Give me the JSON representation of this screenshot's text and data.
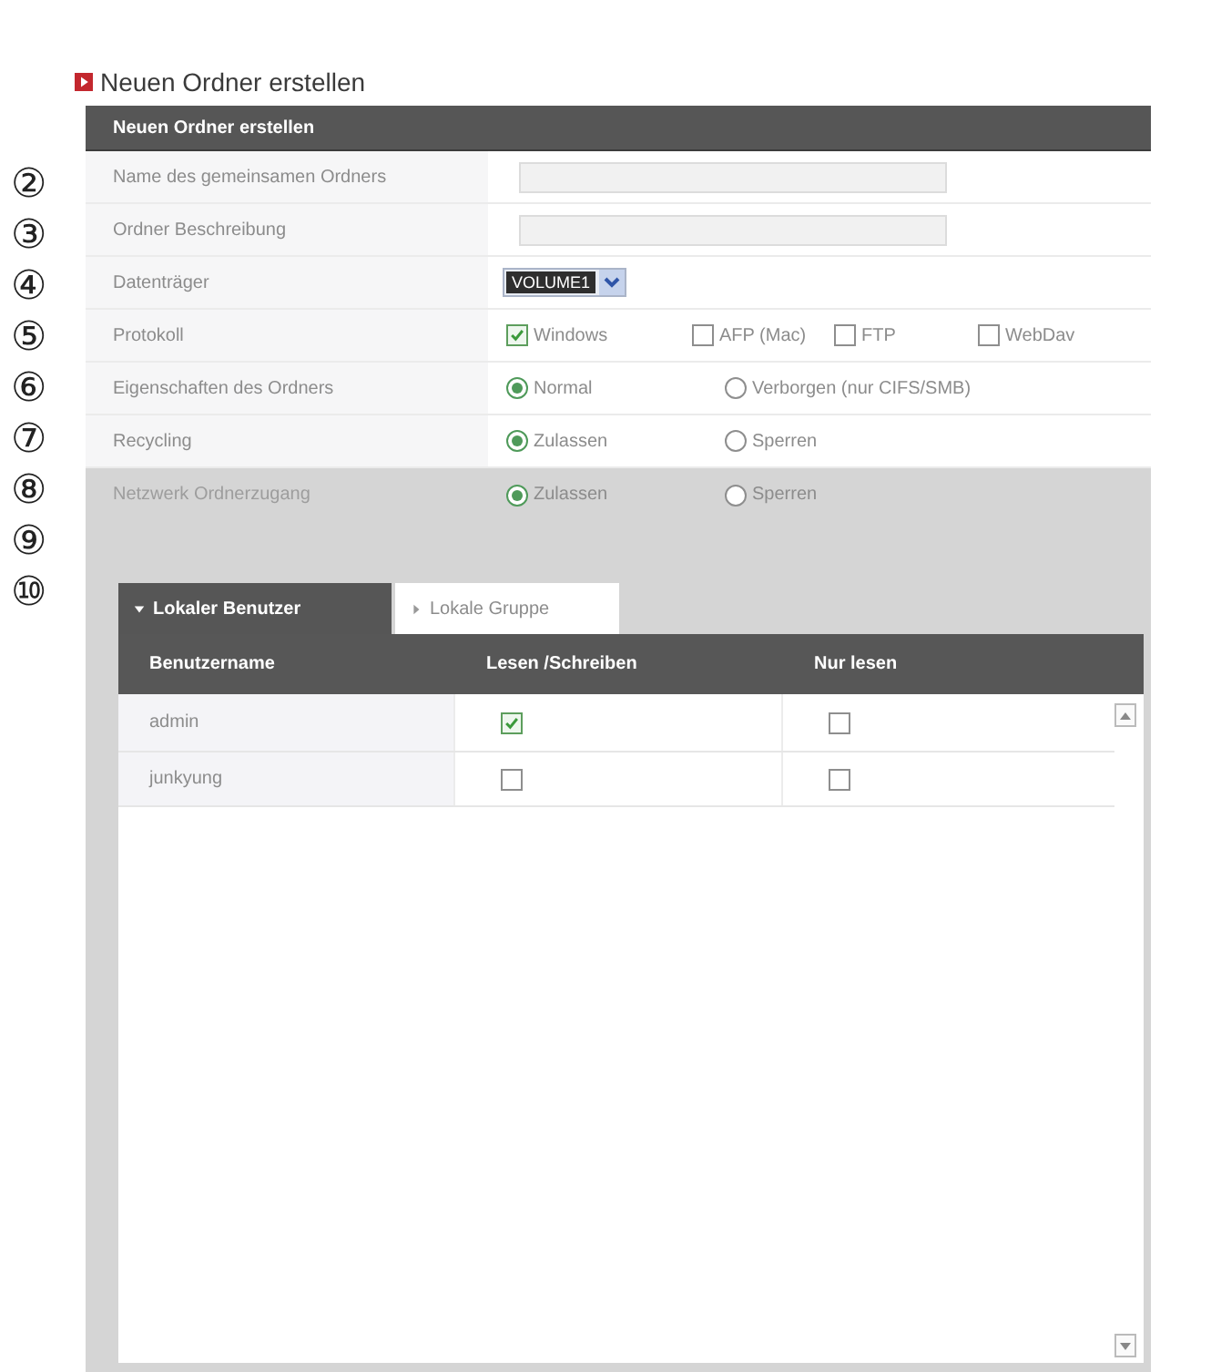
{
  "page_title": "Neuen Ordner erstellen",
  "callouts": [
    "②",
    "③",
    "④",
    "⑤",
    "⑥",
    "⑦",
    "⑧",
    "⑨",
    "⑩"
  ],
  "panel": {
    "title": "Neuen Ordner erstellen",
    "rows": [
      {
        "kind": "text",
        "label": "Name des gemeinsamen Ordners"
      },
      {
        "kind": "text",
        "label": "Ordner Beschreibung"
      },
      {
        "kind": "select",
        "label": "Datenträger",
        "value": "VOLUME1"
      },
      {
        "kind": "checkbox",
        "label": "Protokoll",
        "options": [
          {
            "label": "Windows",
            "checked": true
          },
          {
            "label": "AFP (Mac)",
            "checked": false
          },
          {
            "label": "FTP",
            "checked": false
          },
          {
            "label": "WebDav",
            "checked": false
          }
        ]
      },
      {
        "kind": "radio",
        "label": "Eigenschaften des Ordners",
        "options": [
          {
            "label": "Normal",
            "selected": true
          },
          {
            "label": "Verborgen (nur CIFS/SMB)",
            "selected": false
          }
        ]
      },
      {
        "kind": "radio",
        "label": "Recycling",
        "options": [
          {
            "label": "Zulassen",
            "selected": true
          },
          {
            "label": "Sperren",
            "selected": false
          }
        ]
      }
    ],
    "access": {
      "row": {
        "kind": "radio",
        "label": "Netzwerk Ordnerzugang",
        "options": [
          {
            "label": "Zulassen",
            "selected": true
          },
          {
            "label": "Sperren",
            "selected": false
          }
        ]
      },
      "tabs": [
        {
          "label": "Lokaler Benutzer",
          "selected": true
        },
        {
          "label": "Lokale Gruppe",
          "selected": false
        }
      ],
      "table": {
        "columns": [
          "Benutzername",
          "Lesen /Schreiben",
          "Nur lesen"
        ],
        "rows": [
          {
            "user": "admin",
            "read_write": true,
            "read_only": false
          },
          {
            "user": "junkyung",
            "read_write": false,
            "read_only": false
          }
        ]
      }
    }
  }
}
